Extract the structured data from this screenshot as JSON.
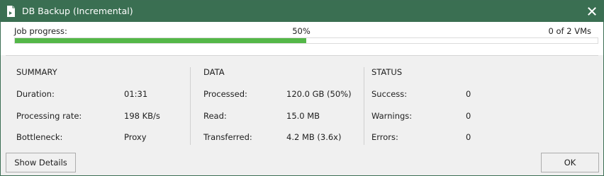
{
  "window": {
    "title": "DB Backup (Incremental)",
    "icon": "backup-job-icon",
    "close_icon": "close-icon"
  },
  "progress": {
    "label": "Job progress:",
    "percent_text": "50%",
    "percent_value": 0.5,
    "count_text": "0 of 2 VMs",
    "fill_color": "#54b748"
  },
  "summary": {
    "title": "SUMMARY",
    "duration_label": "Duration:",
    "duration_value": "01:31",
    "rate_label": "Processing rate:",
    "rate_value": "198 KB/s",
    "bottleneck_label": "Bottleneck:",
    "bottleneck_value": "Proxy"
  },
  "data": {
    "title": "DATA",
    "processed_label": "Processed:",
    "processed_value": "120.0 GB (50%)",
    "read_label": "Read:",
    "read_value": "15.0 MB",
    "transferred_label": "Transferred:",
    "transferred_value": "4.2 MB (3.6x)"
  },
  "status": {
    "title": "STATUS",
    "success_label": "Success:",
    "success_value": "0",
    "warnings_label": "Warnings:",
    "warnings_value": "0",
    "errors_label": "Errors:",
    "errors_value": "0"
  },
  "buttons": {
    "details_label": "Show Details",
    "ok_label": "OK"
  },
  "colors": {
    "titlebar": "#3a6f52",
    "progress_fill": "#54b748"
  }
}
